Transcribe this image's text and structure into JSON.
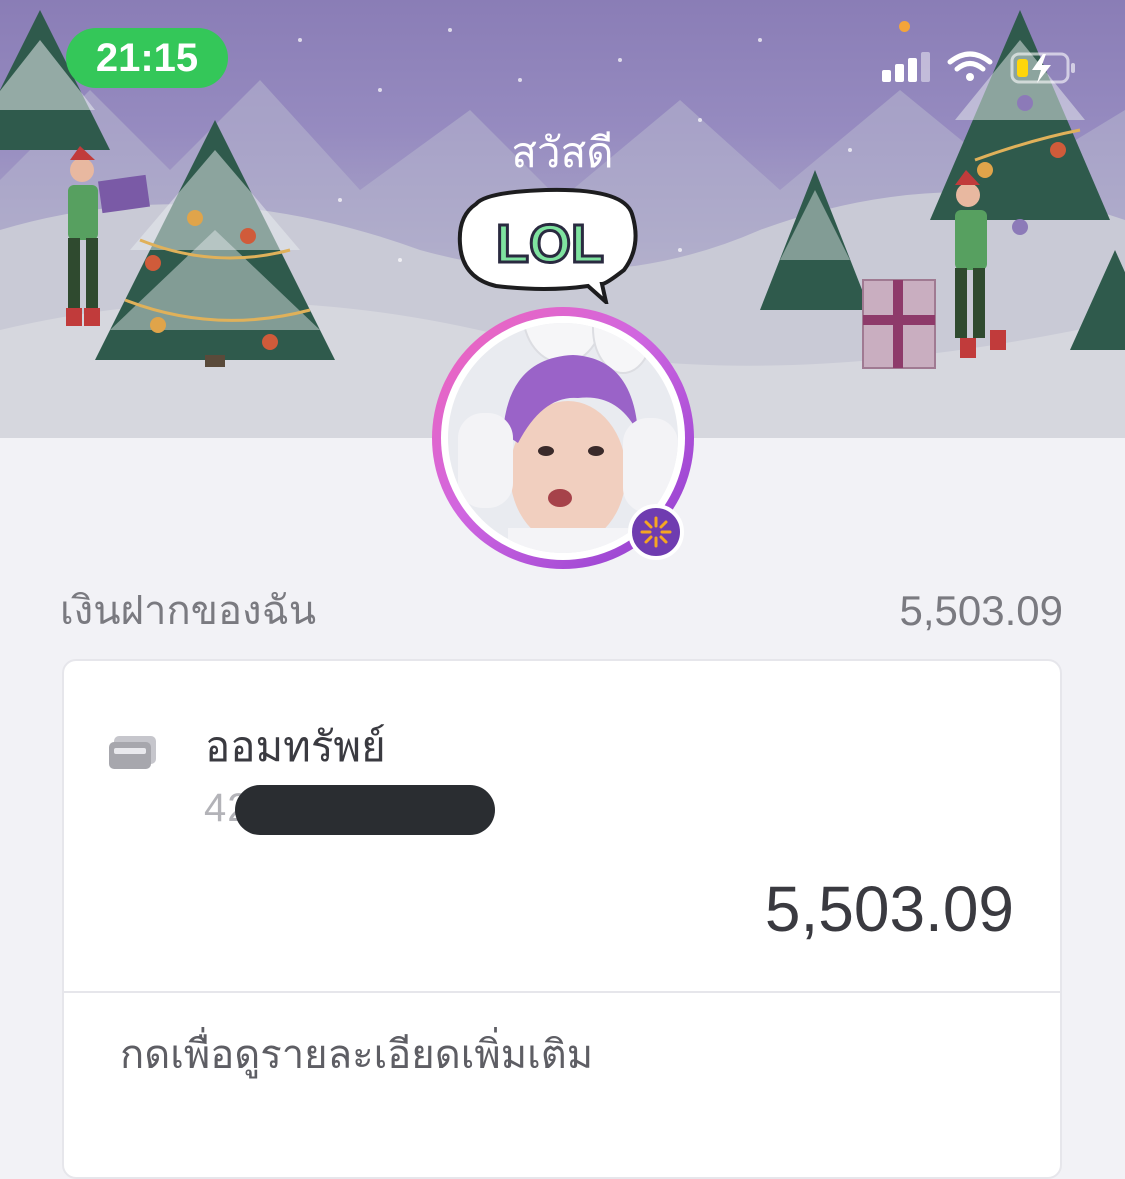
{
  "status_bar": {
    "time": "21:15",
    "icons": [
      "cellular-signal-icon",
      "wifi-icon",
      "battery-charging-icon"
    ]
  },
  "banner": {
    "greeting": "สวัสดี",
    "sticker_text": "LOL",
    "theme": "christmas-snow-trees-elves"
  },
  "profile": {
    "badge_icon": "spark-icon",
    "ring_colors": [
      "#f265b8",
      "#8a3bcf"
    ]
  },
  "deposits": {
    "label": "เงินฝากของฉัน",
    "total": "5,503.09"
  },
  "account_card": {
    "icon": "card-icon",
    "name": "ออมทรัพย์",
    "number_prefix": "42",
    "balance": "5,503.09",
    "more_label": "กดเพื่อดูรายละเอียดเพิ่มเติม"
  },
  "colors": {
    "accent_green": "#34c759",
    "background": "#f2f2f6",
    "text_primary": "#3a3a40",
    "text_secondary": "#7a7a80"
  }
}
